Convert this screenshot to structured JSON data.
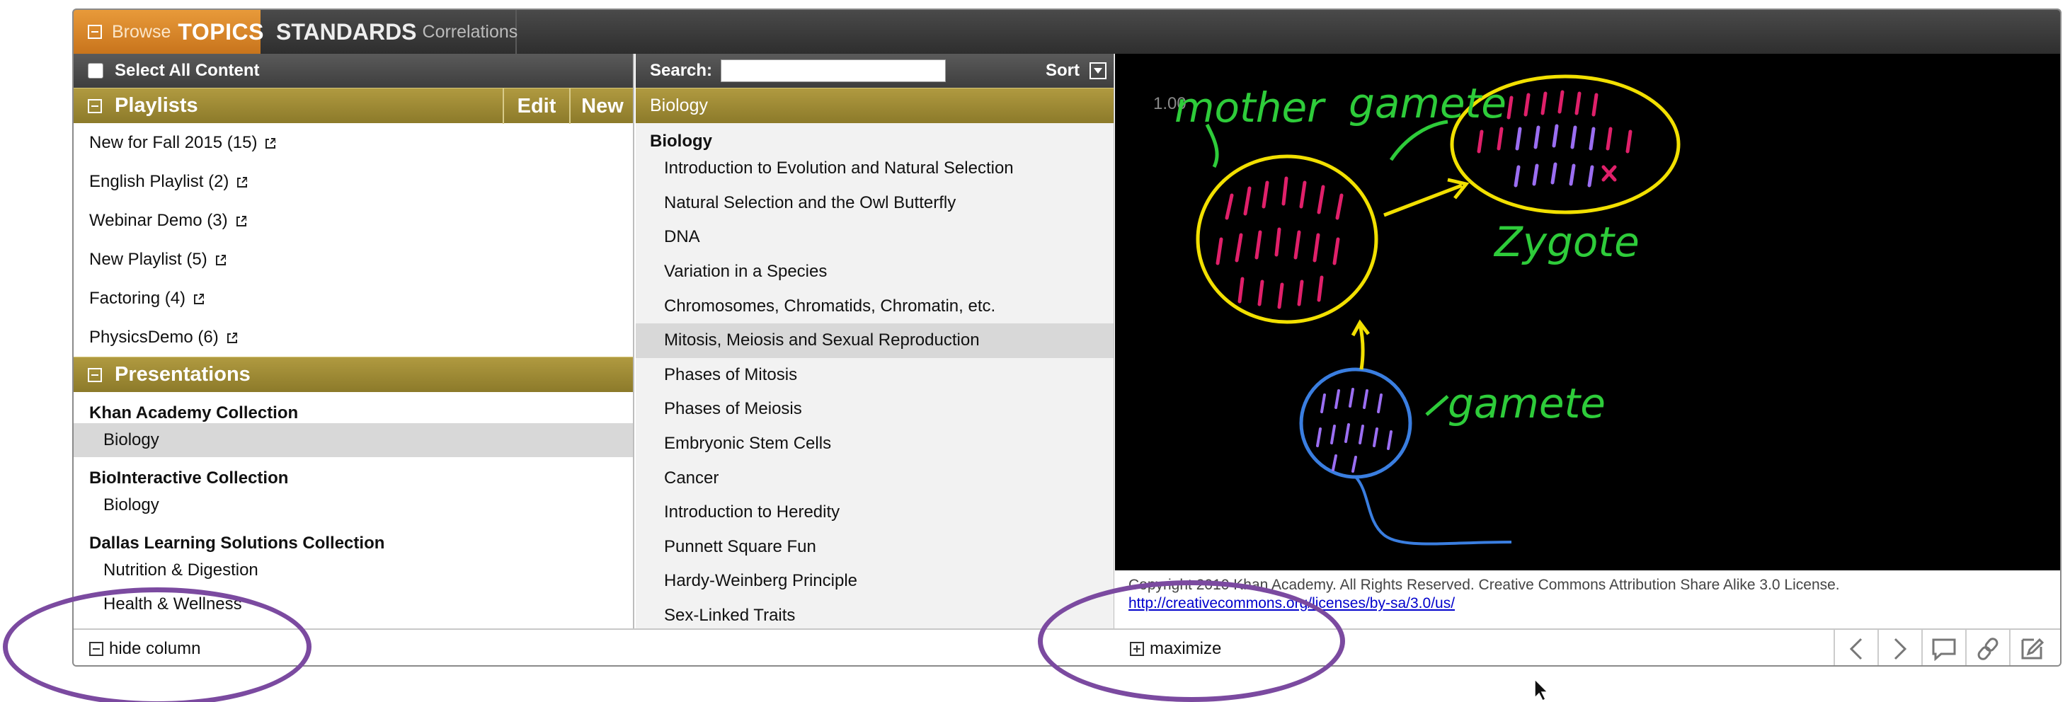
{
  "topbar": {
    "browse_small": "Browse",
    "browse_big": "TOPICS",
    "standards_big": "STANDARDS",
    "standards_small": "Correlations"
  },
  "left": {
    "select_all": "Select All Content",
    "playlists": {
      "title": "Playlists",
      "edit_label": "Edit",
      "new_label": "New",
      "items": [
        "New for Fall 2015 (15)",
        "English Playlist (2)",
        "Webinar Demo (3)",
        "New Playlist (5)",
        "Factoring (4)",
        "PhysicsDemo (6)"
      ]
    },
    "presentations": {
      "title": "Presentations",
      "collections": [
        {
          "name": "Khan Academy Collection",
          "items": [
            "Biology"
          ]
        },
        {
          "name": "BioInteractive Collection",
          "items": [
            "Biology"
          ]
        },
        {
          "name": "Dallas Learning Solutions Collection",
          "items": [
            "Nutrition & Digestion",
            "Health & Wellness"
          ]
        }
      ]
    }
  },
  "middle": {
    "search_label": "Search:",
    "search_value": "",
    "sort_label": "Sort",
    "header": "Biology",
    "subheader": "Biology",
    "lessons": [
      "Introduction to Evolution and Natural Selection",
      "Natural Selection and the Owl Butterfly",
      "DNA",
      "Variation in a Species",
      "Chromosomes, Chromatids, Chromatin, etc.",
      "Mitosis, Meiosis and Sexual Reproduction",
      "Phases of Mitosis",
      "Phases of Meiosis",
      "Embryonic Stem Cells",
      "Cancer",
      "Introduction to Heredity",
      "Punnett Square Fun",
      "Hardy-Weinberg Principle",
      "Sex-Linked Traits"
    ],
    "selected_lesson": "Mitosis, Meiosis and Sexual Reproduction"
  },
  "video": {
    "zoom": "1.00",
    "label_mother": "mother",
    "label_gamete_top": "gamete",
    "label_zygote": "Zygote",
    "label_gamete_bottom": "gamete",
    "copyright": "Copyright 2010 Khan Academy. All Rights Reserved. Creative Commons Attribution Share Alike 3.0 License.",
    "license_url": "http://creativecommons.org/licenses/by-sa/3.0/us/"
  },
  "bottom": {
    "hide_column": "hide column",
    "maximize": "maximize",
    "controls": [
      "prev-icon",
      "next-icon",
      "comment-icon",
      "link-icon",
      "edit-icon"
    ]
  },
  "colors": {
    "accent_orange": "#d8862a",
    "section_olive": "#9e8a36",
    "highlight_purple": "#7b4aa0"
  }
}
